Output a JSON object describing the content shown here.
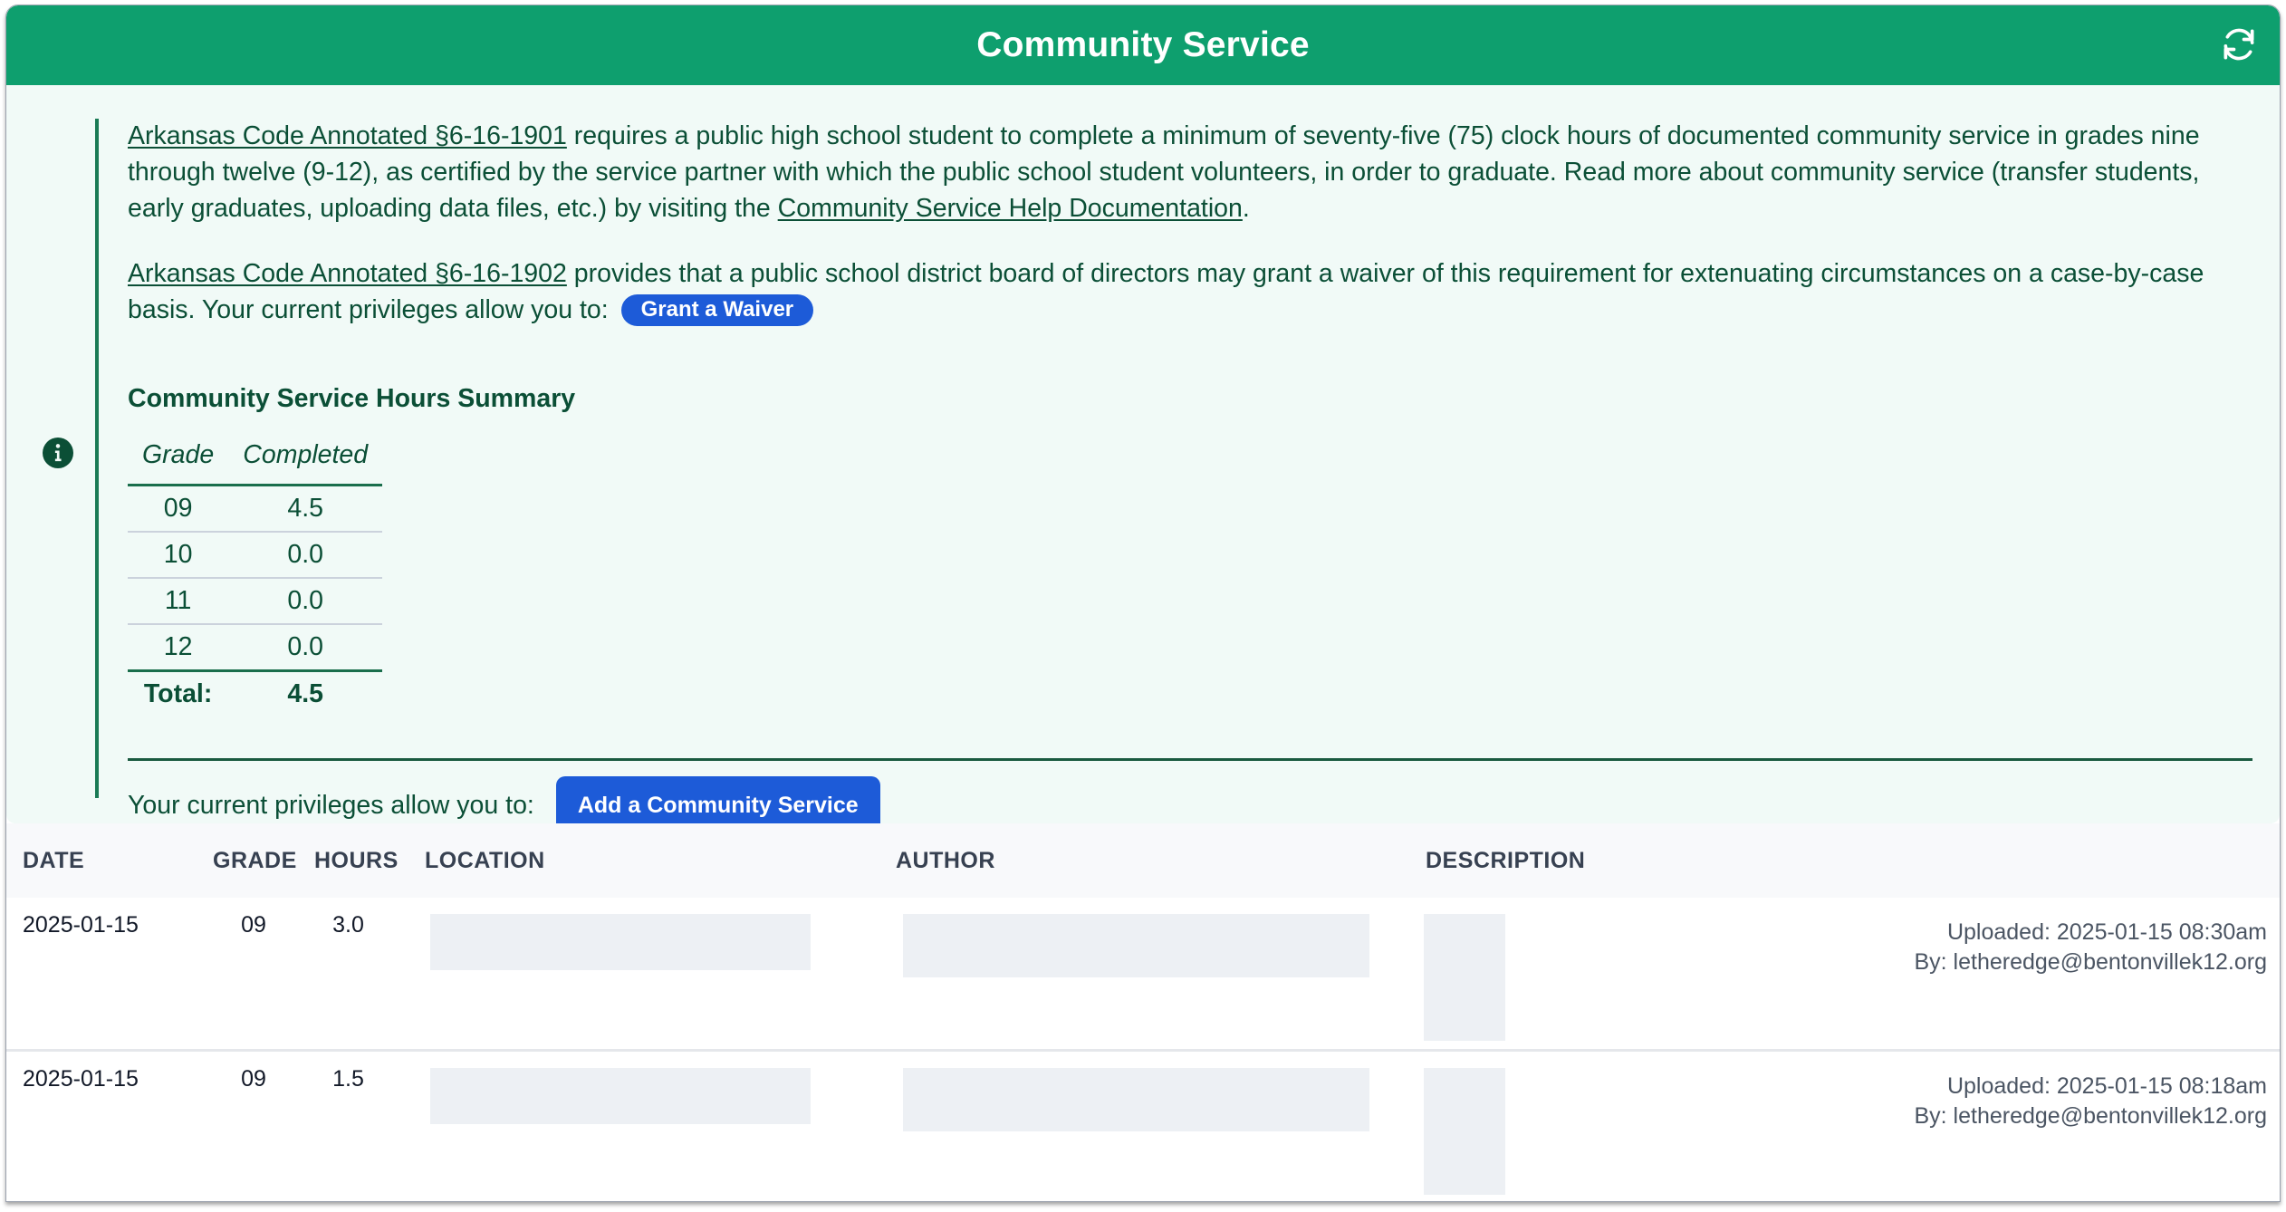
{
  "header": {
    "title": "Community Service",
    "refresh_icon": "refresh-icon"
  },
  "info": {
    "icon": "info-circle-icon",
    "para1": {
      "link1": "Arkansas Code Annotated §6-16-1901",
      "text1": " requires a public high school student to complete a minimum of seventy-five (75) clock hours of documented community service in grades nine through twelve (9-12), as certified by the service partner with which the public school student volunteers, in order to graduate. Read more about community service (transfer students, early graduates, uploading data files, etc.) by visiting the ",
      "link2": "Community Service Help Documentation",
      "text2": "."
    },
    "para2": {
      "link1": "Arkansas Code Annotated §6-16-1902",
      "text1": " provides that a public school district board of directors may grant a waiver of this requirement for extenuating circumstances on a case-by-case basis. Your current privileges allow you to: ",
      "button": "Grant a Waiver"
    },
    "summary": {
      "title": "Community Service Hours Summary",
      "headers": [
        "Grade",
        "Completed"
      ],
      "rows": [
        {
          "grade": "09",
          "completed": "4.5"
        },
        {
          "grade": "10",
          "completed": "0.0"
        },
        {
          "grade": "11",
          "completed": "0.0"
        },
        {
          "grade": "12",
          "completed": "0.0"
        }
      ],
      "total_label": "Total:",
      "total_value": "4.5"
    },
    "privileges_text": "Your current privileges allow you to:",
    "add_button": "Add a Community Service"
  },
  "records": {
    "columns": [
      "DATE",
      "GRADE",
      "HOURS",
      "LOCATION",
      "AUTHOR",
      "DESCRIPTION"
    ],
    "rows": [
      {
        "date": "2025-01-15",
        "grade": "09",
        "hours": "3.0",
        "location": "[redacted]",
        "author": "[redacted]",
        "description": "[redacted]",
        "uploaded": "Uploaded: 2025-01-15 08:30am",
        "by": "By: letheredge@bentonvillek12.org"
      },
      {
        "date": "2025-01-15",
        "grade": "09",
        "hours": "1.5",
        "location": "[redacted]",
        "author": "[redacted]",
        "description": "[redacted]",
        "uploaded": "Uploaded: 2025-01-15 08:18am",
        "by": "By: letheredge@bentonvillek12.org"
      }
    ]
  },
  "colors": {
    "header_green": "#0e9f6e",
    "panel_bg": "#f1faf7",
    "text_green": "#0b4f36",
    "button_blue": "#1d5bd8"
  }
}
